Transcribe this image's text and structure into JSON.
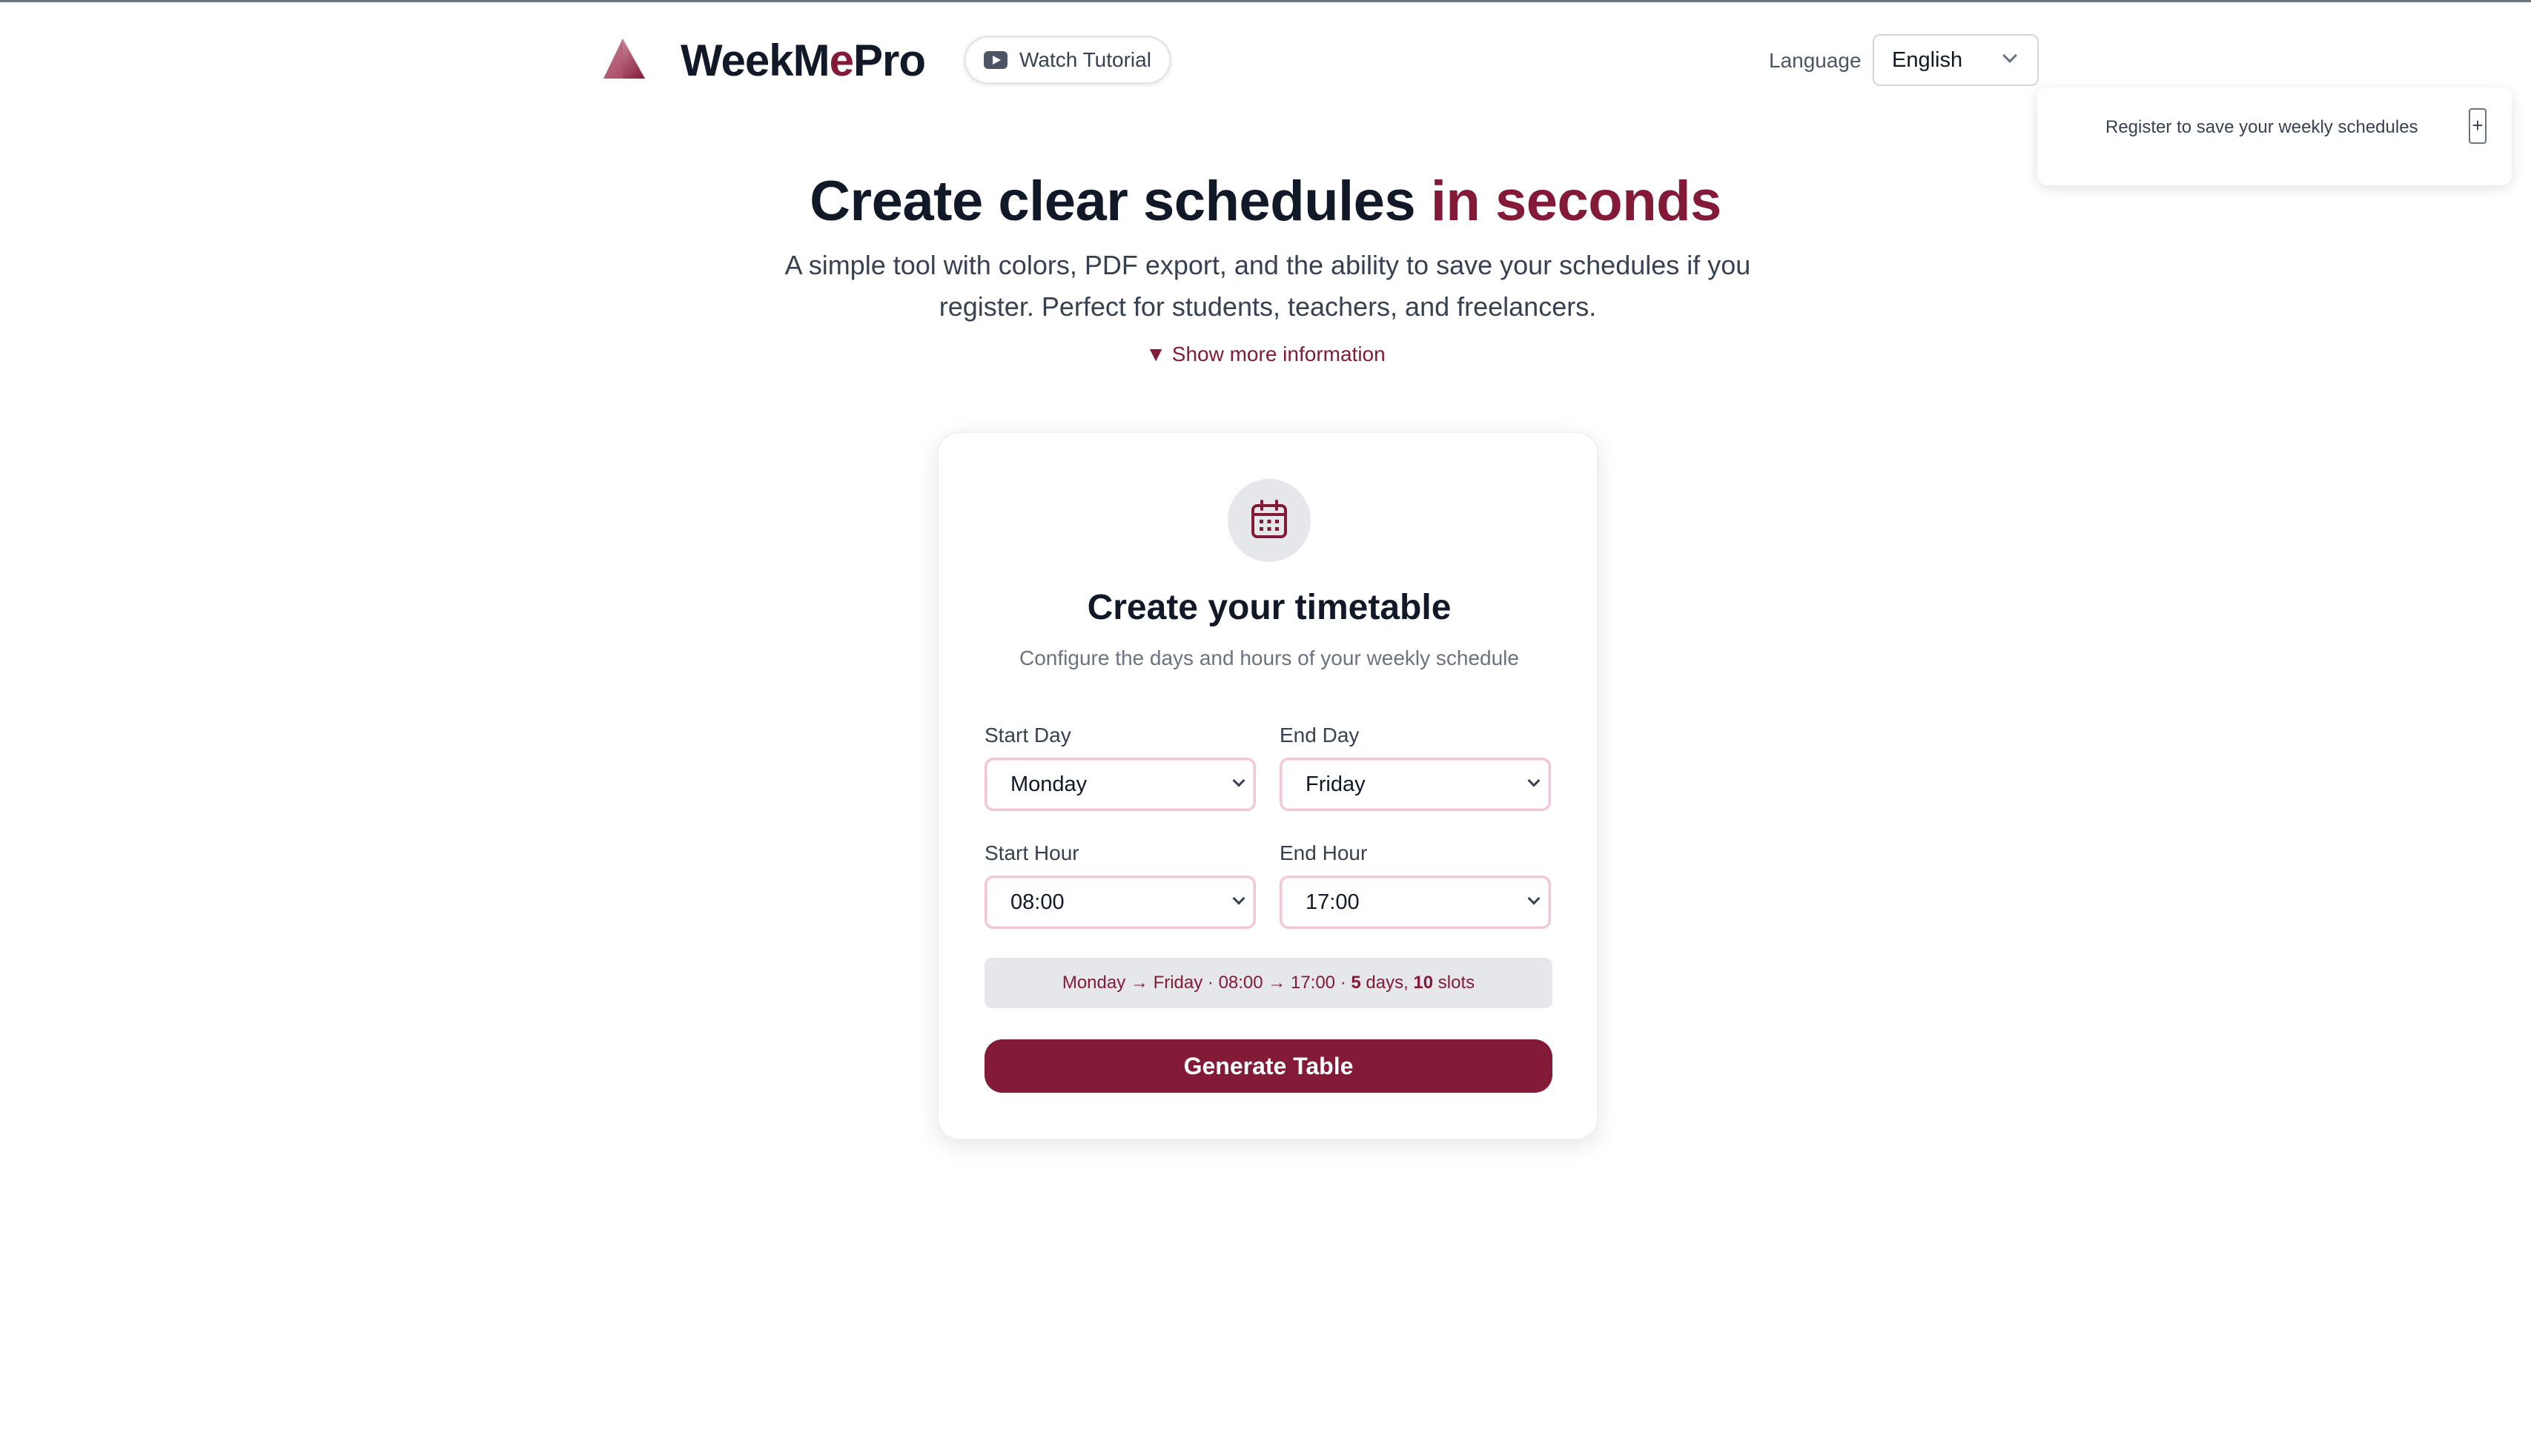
{
  "header": {
    "brand_part1": "WeekM",
    "brand_part2": "e",
    "brand_part3": "Pro",
    "tutorial_label": "Watch Tutorial",
    "language_label": "Language",
    "language_value": "English"
  },
  "toast": {
    "message": "Register to save your weekly schedules",
    "action": "+"
  },
  "hero": {
    "title_main": "Create clear schedules ",
    "title_accent": "in seconds",
    "subtitle": "A simple tool with colors, PDF export, and the ability to save your schedules if you register. Perfect for students, teachers, and freelancers.",
    "show_more": "▼ Show more information"
  },
  "card": {
    "title": "Create your timetable",
    "subtitle": "Configure the days and hours of your weekly schedule",
    "start_day_label": "Start Day",
    "start_day_value": "Monday",
    "end_day_label": "End Day",
    "end_day_value": "Friday",
    "start_hour_label": "Start Hour",
    "start_hour_value": "08:00",
    "end_hour_label": "End Hour",
    "end_hour_value": "17:00",
    "summary_prefix": "Monday → Friday · 08:00 → 17:00 · ",
    "summary_days_count": "5",
    "summary_days_word": " days, ",
    "summary_slots_count": "10",
    "summary_slots_word": " slots",
    "generate_label": "Generate Table"
  },
  "colors": {
    "accent": "#831a37",
    "text": "#111827",
    "muted": "#6b7280"
  },
  "icons": {
    "logo": "triangle-logo-icon",
    "tutorial": "youtube-play-icon",
    "calendar": "calendar-icon"
  }
}
